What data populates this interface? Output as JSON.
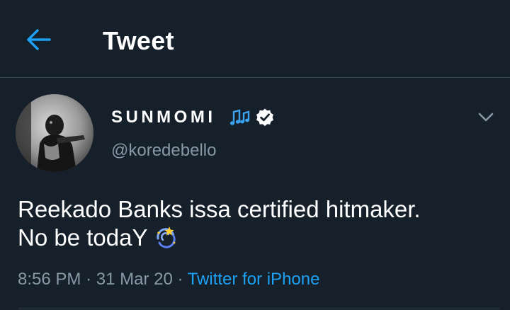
{
  "header": {
    "title": "Tweet",
    "back_icon": "arrow-left-icon"
  },
  "colors": {
    "background": "#15202b",
    "accent": "#1da1f2",
    "secondary_text": "#8899a6",
    "divider": "#38444d"
  },
  "tweet": {
    "author": {
      "display_name": "SUNMOMI",
      "name_emoji": "musical-notes-icon",
      "verified": true,
      "verified_icon": "verified-badge-icon",
      "handle": "@koredebello"
    },
    "more_icon": "chevron-down-icon",
    "text_lines": [
      "Reekado Banks issa certified hitmaker.",
      "No be todaY"
    ],
    "text_emoji": "dizzy-icon",
    "time": "8:56 PM",
    "separator": "·",
    "date": "31 Mar 20",
    "source": "Twitter for iPhone"
  }
}
